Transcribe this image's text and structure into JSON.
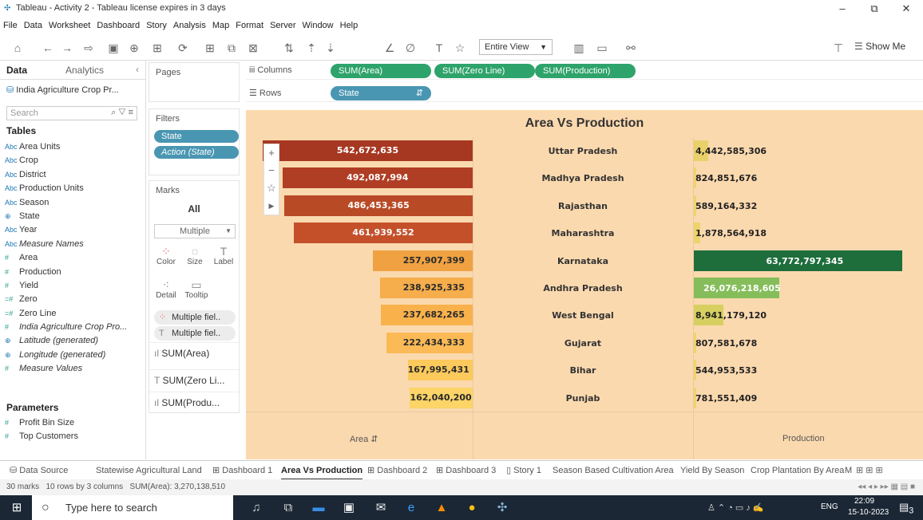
{
  "window": {
    "title": "Tableau - Activity 2 - Tableau license expires in 3 days",
    "minimize": "–",
    "restore": "⧉",
    "close": "✕"
  },
  "menu": [
    "File",
    "Data",
    "Worksheet",
    "Dashboard",
    "Story",
    "Analysis",
    "Map",
    "Format",
    "Server",
    "Window",
    "Help"
  ],
  "toolbar": {
    "view_select": "Entire View",
    "show_me": "Show Me"
  },
  "data_pane": {
    "tab_data": "Data",
    "tab_analytics": "Analytics",
    "datasource": "India Agriculture Crop Pr...",
    "search_placeholder": "Search",
    "tables_title": "Tables",
    "fields": [
      {
        "type": "Abc",
        "name": "Area Units",
        "italic": false
      },
      {
        "type": "Abc",
        "name": "Crop",
        "italic": false
      },
      {
        "type": "Abc",
        "name": "District",
        "italic": false
      },
      {
        "type": "Abc",
        "name": "Production Units",
        "italic": false
      },
      {
        "type": "Abc",
        "name": "Season",
        "italic": false
      },
      {
        "type": "⊕",
        "name": "State",
        "italic": false
      },
      {
        "type": "Abc",
        "name": "Year",
        "italic": false
      },
      {
        "type": "Abc",
        "name": "Measure Names",
        "italic": true
      },
      {
        "type": "#",
        "name": "Area",
        "italic": false
      },
      {
        "type": "#",
        "name": "Production",
        "italic": false
      },
      {
        "type": "#",
        "name": "Yield",
        "italic": false
      },
      {
        "type": "=#",
        "name": "Zero",
        "italic": false
      },
      {
        "type": "=#",
        "name": "Zero Line",
        "italic": false
      },
      {
        "type": "#",
        "name": "India Agriculture Crop Pro...",
        "italic": true
      },
      {
        "type": "⊕",
        "name": "Latitude (generated)",
        "italic": true
      },
      {
        "type": "⊕",
        "name": "Longitude (generated)",
        "italic": true
      },
      {
        "type": "#",
        "name": "Measure Values",
        "italic": true
      }
    ],
    "parameters_title": "Parameters",
    "parameters": [
      {
        "type": "#",
        "name": "Profit Bin Size"
      },
      {
        "type": "#",
        "name": "Top Customers"
      }
    ]
  },
  "pages": {
    "title": "Pages"
  },
  "filters": {
    "title": "Filters",
    "items": [
      "State",
      "Action (State)"
    ]
  },
  "marks": {
    "title": "Marks",
    "all": "All",
    "type": "Multiple",
    "buttons": [
      "Color",
      "Size",
      "Label",
      "Detail",
      "Tooltip"
    ],
    "encodings": [
      "Multiple fiel..",
      "Multiple fiel.."
    ],
    "cards": [
      "SUM(Area)",
      "SUM(Zero Li...",
      "SUM(Produ..."
    ]
  },
  "shelves": {
    "columns_label": "Columns",
    "rows_label": "Rows",
    "columns": [
      "SUM(Area)",
      "SUM(Zero Line)",
      "SUM(Production)"
    ],
    "rows": [
      "State"
    ]
  },
  "chart_data": {
    "type": "bar",
    "title": "Area Vs Production",
    "categories": [
      "Uttar Pradesh",
      "Madhya Pradesh",
      "Rajasthan",
      "Maharashtra",
      "Karnataka",
      "Andhra Pradesh",
      "West Bengal",
      "Gujarat",
      "Bihar",
      "Punjab"
    ],
    "series": [
      {
        "name": "Area",
        "values": [
          542672635,
          492087994,
          486453365,
          461939552,
          257907399,
          238925335,
          237682265,
          222434333,
          167995431,
          162040200
        ],
        "labels": [
          "542,672,635",
          "492,087,994",
          "486,453,365",
          "461,939,552",
          "257,907,399",
          "238,925,335",
          "237,682,265",
          "222,434,333",
          "167,995,431",
          "162,040,200"
        ],
        "colors": [
          "#a63822",
          "#b03e24",
          "#b84a26",
          "#c4502a",
          "#f0a243",
          "#f6ad4c",
          "#f8b14b",
          "#fbba56",
          "#fbc95c",
          "#fcd467"
        ]
      },
      {
        "name": "Production",
        "values": [
          4442585306,
          824851676,
          589164332,
          1878564918,
          63772797345,
          26076218605,
          8941179120,
          807581678,
          544953533,
          781551409
        ],
        "labels": [
          "4,442,585,306",
          "824,851,676",
          "589,164,332",
          "1,878,564,918",
          "63,772,797,345",
          "26,076,218,605",
          "8,941,179,120",
          "807,581,678",
          "544,953,533",
          "781,551,409"
        ],
        "colors": [
          "#e9d16a",
          "#f1d46b",
          "#f1d46b",
          "#ecd36b",
          "#1e6e3c",
          "#85bd5a",
          "#d7d061",
          "#f1d46b",
          "#f1d46b",
          "#f1d46b"
        ]
      }
    ],
    "xlabel_area": "Area",
    "xlabel_production": "Production"
  },
  "sheet_tabs": [
    "Data Source",
    "Statewise Agricultural Land",
    "Dashboard 1",
    "Area Vs Production",
    "Dashboard 2",
    "Dashboard 3",
    "Story 1",
    "Season Based Cultivation Area",
    "Yield By Season",
    "Crop Plantation By Area",
    "M"
  ],
  "active_tab": "Area Vs Production",
  "status": {
    "marks": "30 marks",
    "dims": "10 rows by 3 columns",
    "sum": "SUM(Area): 3,270,138,510"
  },
  "taskbar": {
    "search": "Type here to search",
    "time": "22:09",
    "date": "15-10-2023",
    "lang": "ENG",
    "notif": "3"
  }
}
